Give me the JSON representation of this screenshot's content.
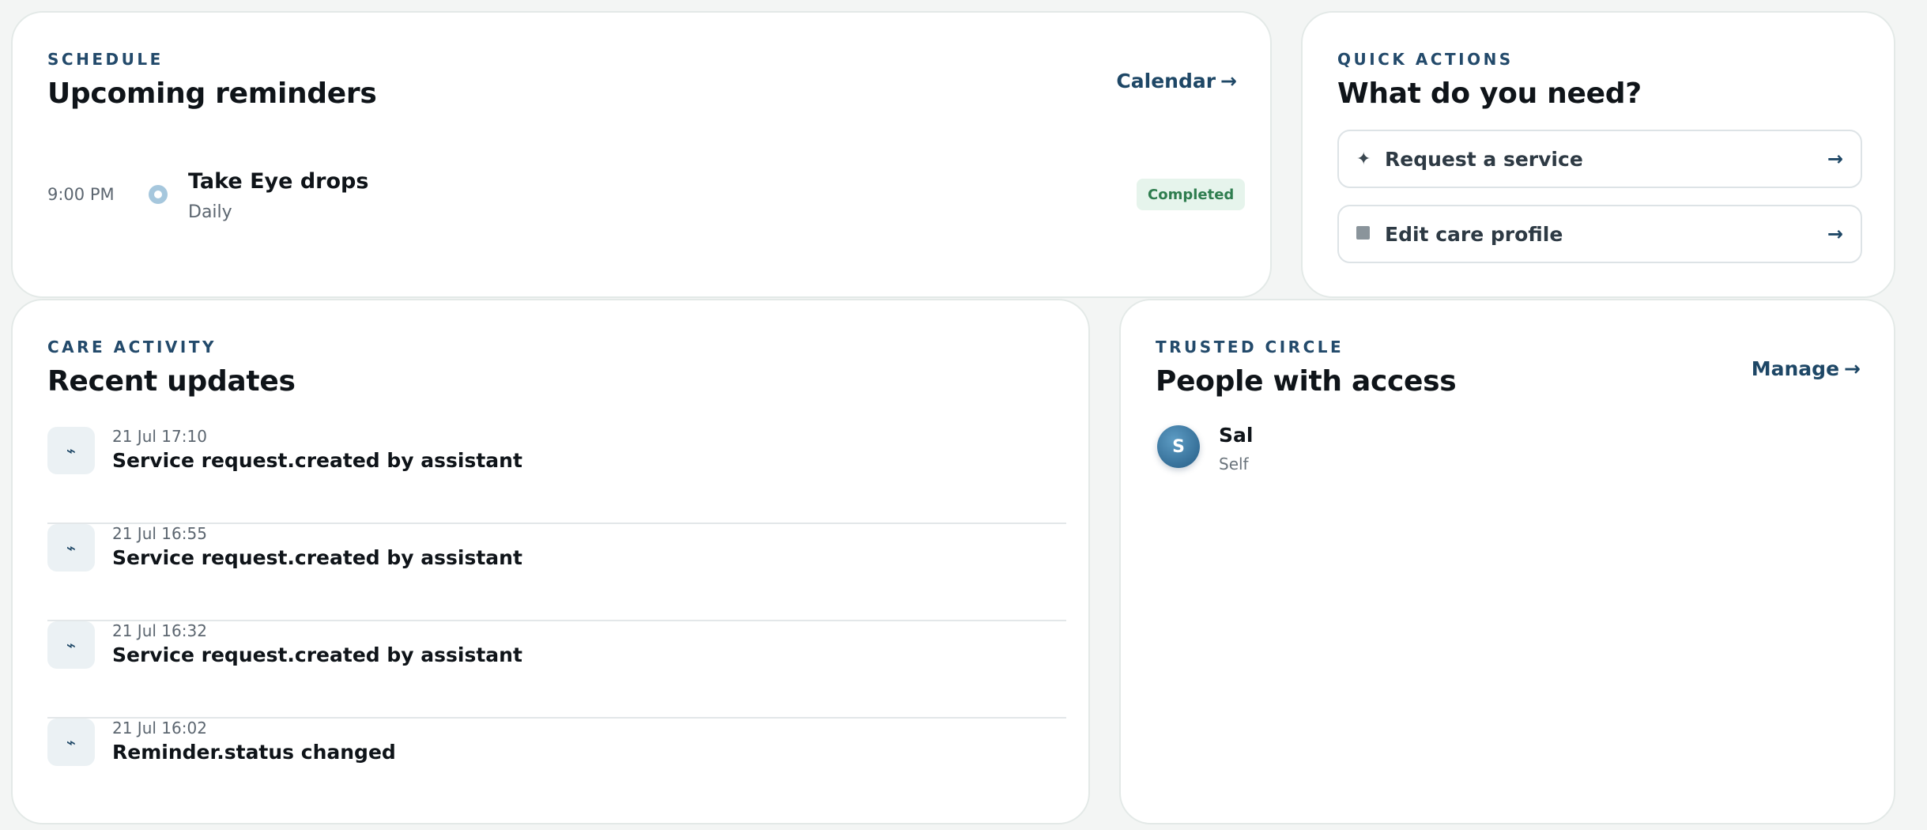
{
  "schedule": {
    "eyebrow": "SCHEDULE",
    "title": "Upcoming reminders",
    "link_label": "Calendar",
    "link_arrow": "→",
    "reminders": [
      {
        "time": "9:00 PM",
        "title": "Take Eye drops",
        "frequency": "Daily",
        "status": "Completed"
      }
    ]
  },
  "quick_actions": {
    "eyebrow": "QUICK ACTIONS",
    "title": "What do you need?",
    "actions": [
      {
        "icon": "sparkle-icon",
        "glyph": "✦",
        "label": "Request a service",
        "arrow": "→"
      },
      {
        "icon": "square-icon",
        "label": "Edit care profile",
        "arrow": "→"
      }
    ]
  },
  "activity": {
    "eyebrow": "CARE ACTIVITY",
    "title": "Recent updates",
    "icon_glyph": "⌁",
    "items": [
      {
        "time": "21 Jul 17:10",
        "text": "Service request.created by assistant"
      },
      {
        "time": "21 Jul 16:55",
        "text": "Service request.created by assistant"
      },
      {
        "time": "21 Jul 16:32",
        "text": "Service request.created by assistant"
      },
      {
        "time": "21 Jul 16:02",
        "text": "Reminder.status changed"
      }
    ]
  },
  "trusted_circle": {
    "eyebrow": "TRUSTED CIRCLE",
    "title": "People with access",
    "link_label": "Manage",
    "link_arrow": "→",
    "people": [
      {
        "initial": "S",
        "name": "Sal",
        "role": "Self"
      }
    ]
  },
  "colors": {
    "accent": "#1e4766",
    "badge_bg": "#e6f4ec",
    "badge_text": "#2f7d4f",
    "background": "#f3f5f4"
  }
}
